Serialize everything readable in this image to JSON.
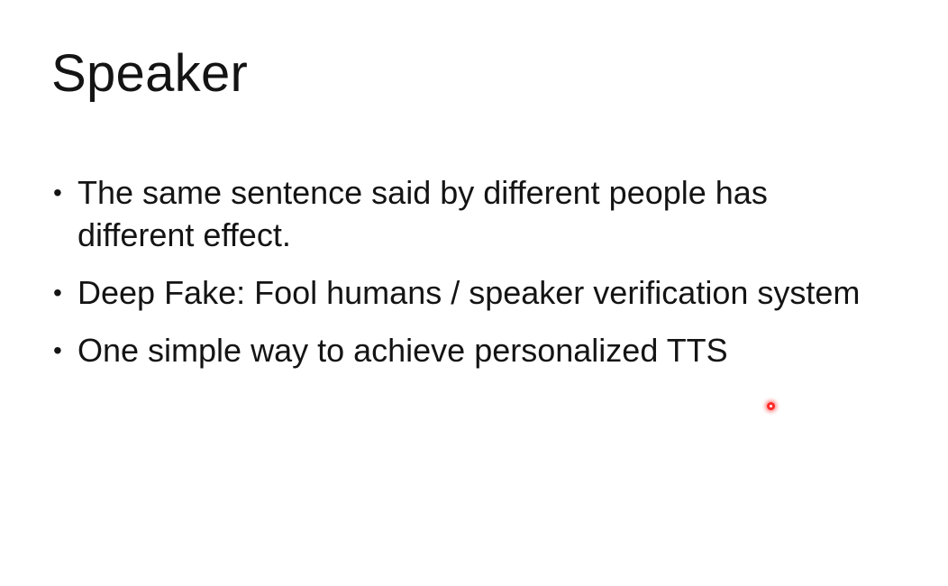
{
  "slide": {
    "title": "Speaker",
    "bullets": [
      {
        "marker": "•",
        "text": "The same sentence said by different people has different effect."
      },
      {
        "marker": "•",
        "text": "Deep Fake: Fool humans / speaker verification system"
      },
      {
        "marker": "•",
        "text": "One simple way to achieve personalized TTS"
      }
    ]
  },
  "colors": {
    "background": "#ffffff",
    "text": "#141414",
    "pointer": "#ff2a2a"
  }
}
